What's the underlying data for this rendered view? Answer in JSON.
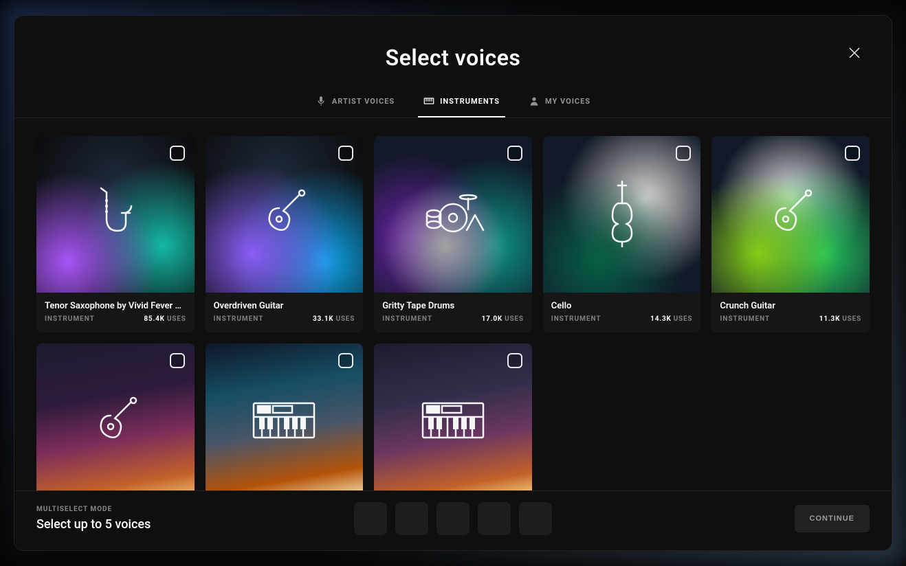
{
  "modal": {
    "title": "Select voices",
    "close_label": "Close",
    "tabs": [
      {
        "label": "ARTIST VOICES",
        "key": "artist"
      },
      {
        "label": "INSTRUMENTS",
        "key": "instruments"
      },
      {
        "label": "MY VOICES",
        "key": "my"
      }
    ],
    "active_tab": "instruments"
  },
  "cards": [
    {
      "title": "Tenor Saxophone by Vivid Fever Dr…",
      "type": "INSTRUMENT",
      "uses": "85.4K",
      "uses_label": "USES",
      "icon": "saxophone",
      "bg": "bg-aurora-1"
    },
    {
      "title": "Overdriven Guitar",
      "type": "INSTRUMENT",
      "uses": "33.1K",
      "uses_label": "USES",
      "icon": "guitar",
      "bg": "bg-aurora-2"
    },
    {
      "title": "Gritty Tape Drums",
      "type": "INSTRUMENT",
      "uses": "17.0K",
      "uses_label": "USES",
      "icon": "drums",
      "bg": "bg-aurora-3"
    },
    {
      "title": "Cello",
      "type": "INSTRUMENT",
      "uses": "14.3K",
      "uses_label": "USES",
      "icon": "cello",
      "bg": "bg-aurora-4"
    },
    {
      "title": "Crunch Guitar",
      "type": "INSTRUMENT",
      "uses": "11.3K",
      "uses_label": "USES",
      "icon": "guitar",
      "bg": "bg-aurora-5"
    },
    {
      "title": "",
      "type": "",
      "uses": "",
      "uses_label": "",
      "icon": "guitar",
      "bg": "bg-sunset-1",
      "partial": true
    },
    {
      "title": "",
      "type": "",
      "uses": "",
      "uses_label": "",
      "icon": "keyboard",
      "bg": "bg-sunset-2",
      "partial": true
    },
    {
      "title": "",
      "type": "",
      "uses": "",
      "uses_label": "",
      "icon": "keyboard",
      "bg": "bg-sunset-3",
      "partial": true
    }
  ],
  "footer": {
    "mode_label": "MULTISELECT MODE",
    "mode_text": "Select up to 5 voices",
    "slot_count": 5,
    "continue_label": "CONTINUE"
  }
}
